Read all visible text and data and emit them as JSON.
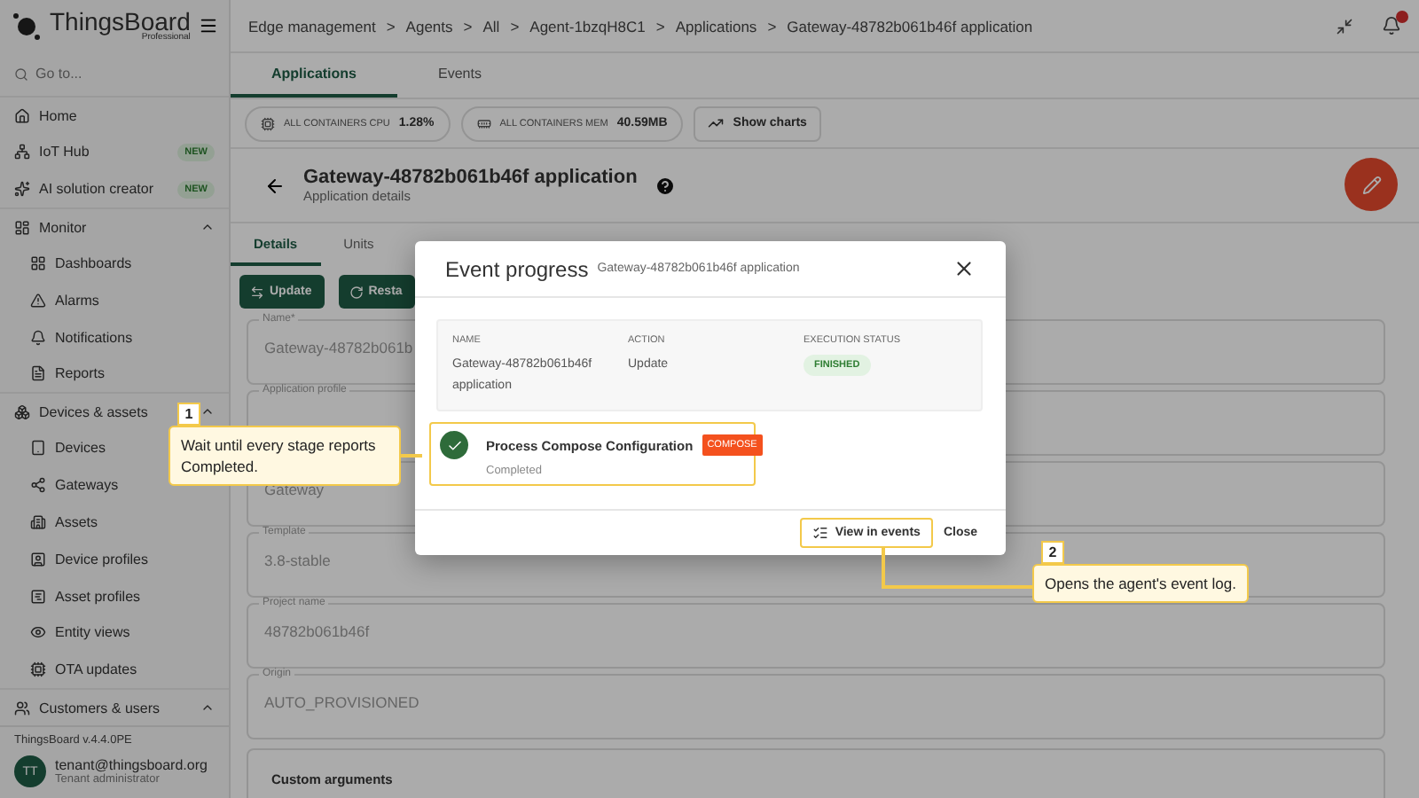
{
  "app": {
    "logo": "ThingsBoard",
    "logo_sub": "Professional"
  },
  "search": {
    "placeholder": "Go to..."
  },
  "sidebar": {
    "items": [
      {
        "label": "Home"
      },
      {
        "label": "IoT Hub",
        "badge": "NEW"
      },
      {
        "label": "AI solution creator",
        "badge": "NEW"
      },
      {
        "label": "Monitor",
        "expanded": true,
        "children": [
          {
            "label": "Dashboards"
          },
          {
            "label": "Alarms"
          },
          {
            "label": "Notifications"
          },
          {
            "label": "Reports"
          }
        ]
      },
      {
        "label": "Devices & assets",
        "expanded": true,
        "children": [
          {
            "label": "Devices"
          },
          {
            "label": "Gateways"
          },
          {
            "label": "Assets"
          },
          {
            "label": "Device profiles"
          },
          {
            "label": "Asset profiles"
          },
          {
            "label": "Entity views"
          },
          {
            "label": "OTA updates"
          }
        ]
      },
      {
        "label": "Customers & users",
        "expanded": true
      }
    ]
  },
  "version": "ThingsBoard v.4.4.0PE",
  "user": {
    "initials": "TT",
    "email": "tenant@thingsboard.org",
    "role": "Tenant administrator"
  },
  "breadcrumb_separator": ">",
  "breadcrumbs": [
    "Edge management",
    "Agents",
    "All",
    "Agent-1bzqH8C1",
    "Applications",
    "Gateway-48782b061b46f application"
  ],
  "tabs": [
    {
      "label": "Applications",
      "selected": true
    },
    {
      "label": "Events",
      "selected": false
    }
  ],
  "stats": [
    {
      "label": "ALL CONTAINERS CPU",
      "value": "1.28%"
    },
    {
      "label": "ALL CONTAINERS MEM",
      "value": "40.59MB"
    }
  ],
  "show_charts": "Show charts",
  "header": {
    "title": "Gateway-48782b061b46f application",
    "subtitle": "Application details"
  },
  "detail_tabs": [
    {
      "label": "Details",
      "selected": true
    },
    {
      "label": "Units",
      "selected": false
    }
  ],
  "actions": [
    "Update",
    "Resta"
  ],
  "fields": [
    {
      "label": "Name*",
      "value": "Gateway-48782b061b"
    },
    {
      "label": "Application profile"
    },
    {
      "value": "Gateway"
    },
    {
      "label": "Template",
      "value": "3.8-stable"
    },
    {
      "label": "Project name",
      "value": "48782b061b46f"
    },
    {
      "label": "Origin",
      "value": "AUTO_PROVISIONED"
    }
  ],
  "custom_arguments": "Custom arguments",
  "dialog": {
    "title": "Event progress",
    "subtitle": "Gateway-48782b061b46f application",
    "columns": [
      "NAME",
      "ACTION",
      "EXECUTION STATUS"
    ],
    "row": {
      "name": "Gateway-48782b061b46f application",
      "action": "Update",
      "status": "FINISHED"
    },
    "stage": {
      "title": "Process Compose Configuration",
      "tag": "COMPOSE",
      "status": "Completed",
      "done": true
    },
    "buttons": [
      "View in events",
      "Close"
    ]
  },
  "callouts": [
    {
      "number": "1",
      "text": "Wait until every stage reports Completed."
    },
    {
      "number": "2",
      "text": "Opens the agent's event log."
    }
  ]
}
